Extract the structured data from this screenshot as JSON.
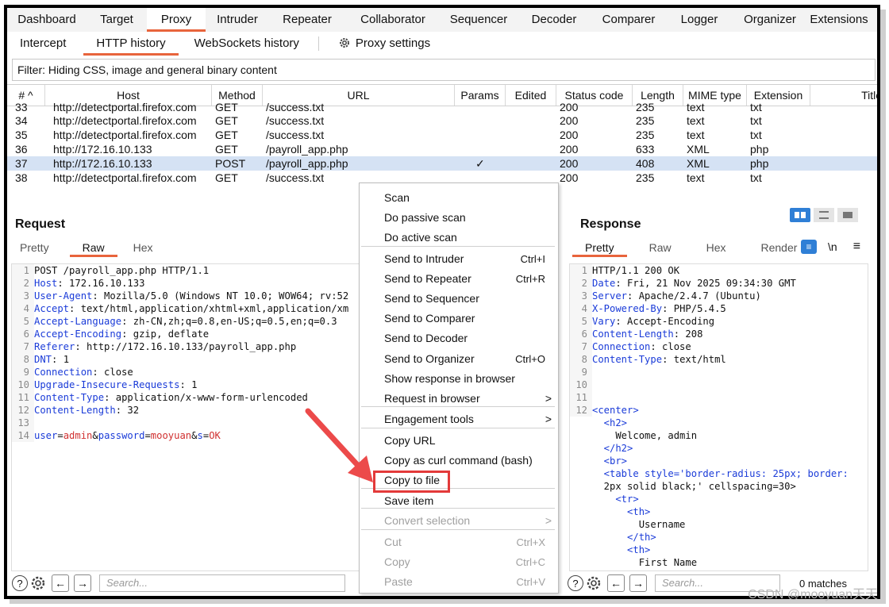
{
  "top_tabs": [
    "Dashboard",
    "Target",
    "Proxy",
    "Intruder",
    "Repeater",
    "Collaborator",
    "Sequencer",
    "Decoder",
    "Comparer",
    "Logger",
    "Organizer",
    "Extensions"
  ],
  "sub_tabs": [
    "Intercept",
    "HTTP history",
    "WebSockets history"
  ],
  "proxy_settings": "Proxy settings",
  "filter": "Filter: Hiding CSS, image and general binary content",
  "table": {
    "headers": [
      "# ^",
      "Host",
      "Method",
      "URL",
      "Params",
      "Edited",
      "Status code",
      "Length",
      "MIME type",
      "Extension",
      "Title"
    ],
    "rows": [
      {
        "n": "33",
        "host": "http://detectportal.firefox.com",
        "method": "GET",
        "url": "/success.txt",
        "params": "",
        "status": "200",
        "length": "235",
        "mime": "text",
        "ext": "txt"
      },
      {
        "n": "34",
        "host": "http://detectportal.firefox.com",
        "method": "GET",
        "url": "/success.txt",
        "params": "",
        "status": "200",
        "length": "235",
        "mime": "text",
        "ext": "txt"
      },
      {
        "n": "35",
        "host": "http://detectportal.firefox.com",
        "method": "GET",
        "url": "/success.txt",
        "params": "",
        "status": "200",
        "length": "235",
        "mime": "text",
        "ext": "txt"
      },
      {
        "n": "36",
        "host": "http://172.16.10.133",
        "method": "GET",
        "url": "/payroll_app.php",
        "params": "",
        "status": "200",
        "length": "633",
        "mime": "XML",
        "ext": "php"
      },
      {
        "n": "37",
        "host": "http://172.16.10.133",
        "method": "POST",
        "url": "/payroll_app.php",
        "params": "✓",
        "status": "200",
        "length": "408",
        "mime": "XML",
        "ext": "php"
      },
      {
        "n": "38",
        "host": "http://detectportal.firefox.com",
        "method": "GET",
        "url": "/success.txt",
        "params": "",
        "status": "200",
        "length": "235",
        "mime": "text",
        "ext": "txt"
      }
    ]
  },
  "request": {
    "title": "Request",
    "tabs": [
      "Pretty",
      "Raw",
      "Hex"
    ],
    "lines": [
      {
        "n": "1",
        "k": "",
        "t": "POST /payroll_app.php HTTP/1.1"
      },
      {
        "n": "2",
        "k": "Host",
        "t": ": 172.16.10.133"
      },
      {
        "n": "3",
        "k": "User-Agent",
        "t": ": Mozilla/5.0 (Windows NT 10.0; WOW64; rv:52"
      },
      {
        "n": "4",
        "k": "Accept",
        "t": ": text/html,application/xhtml+xml,application/xm"
      },
      {
        "n": "5",
        "k": "Accept-Language",
        "t": ": zh-CN,zh;q=0.8,en-US;q=0.5,en;q=0.3"
      },
      {
        "n": "6",
        "k": "Accept-Encoding",
        "t": ": gzip, deflate"
      },
      {
        "n": "7",
        "k": "Referer",
        "t": ": http://172.16.10.133/payroll_app.php"
      },
      {
        "n": "8",
        "k": "DNT",
        "t": ": 1"
      },
      {
        "n": "9",
        "k": "Connection",
        "t": ": close"
      },
      {
        "n": "10",
        "k": "Upgrade-Insecure-Requests",
        "t": ": 1"
      },
      {
        "n": "11",
        "k": "Content-Type",
        "t": ": application/x-www-form-urlencoded"
      },
      {
        "n": "12",
        "k": "Content-Length",
        "t": ": 32"
      },
      {
        "n": "13",
        "k": "",
        "t": ""
      },
      {
        "n": "14",
        "k": "",
        "t": ""
      }
    ],
    "body": [
      {
        "k": "user",
        "v": "admin"
      },
      {
        "k": "password",
        "v": "mooyuan"
      },
      {
        "k": "s",
        "v": "OK"
      }
    ],
    "search_placeholder": "Search..."
  },
  "response": {
    "title": "Response",
    "tabs": [
      "Pretty",
      "Raw",
      "Hex",
      "Render"
    ],
    "newline_icon": "\\n",
    "lines": [
      {
        "n": "1",
        "k": "",
        "t": "HTTP/1.1 200 OK"
      },
      {
        "n": "2",
        "k": "Date",
        "t": ": Fri, 21 Nov 2025 09:34:30 GMT"
      },
      {
        "n": "3",
        "k": "Server",
        "t": ": Apache/2.4.7 (Ubuntu)"
      },
      {
        "n": "4",
        "k": "X-Powered-By",
        "t": ": PHP/5.4.5"
      },
      {
        "n": "5",
        "k": "Vary",
        "t": ": Accept-Encoding"
      },
      {
        "n": "6",
        "k": "Content-Length",
        "t": ": 208"
      },
      {
        "n": "7",
        "k": "Connection",
        "t": ": close"
      },
      {
        "n": "8",
        "k": "Content-Type",
        "t": ": text/html"
      },
      {
        "n": "9",
        "k": "",
        "t": ""
      },
      {
        "n": "10",
        "k": "",
        "t": ""
      },
      {
        "n": "11",
        "k": "",
        "t": ""
      },
      {
        "n": "12",
        "k": "",
        "t": "<center>"
      },
      {
        "n": "",
        "k": "",
        "t": "  <h2>"
      },
      {
        "n": "",
        "k": "",
        "t": "    Welcome, admin"
      },
      {
        "n": "",
        "k": "",
        "t": "  </h2>"
      },
      {
        "n": "",
        "k": "",
        "t": "  <br>"
      },
      {
        "n": "",
        "k": "",
        "t": "  <table style='border-radius: 25px; border:"
      },
      {
        "n": "",
        "k": "",
        "t": "  2px solid black;' cellspacing=30>"
      },
      {
        "n": "",
        "k": "",
        "t": "    <tr>"
      },
      {
        "n": "",
        "k": "",
        "t": "      <th>"
      },
      {
        "n": "",
        "k": "",
        "t": "        Username"
      },
      {
        "n": "",
        "k": "",
        "t": "      </th>"
      },
      {
        "n": "",
        "k": "",
        "t": "      <th>"
      },
      {
        "n": "",
        "k": "",
        "t": "        First Name"
      }
    ],
    "search_placeholder": "Search...",
    "matches": "0 matches"
  },
  "menu": {
    "items": [
      {
        "label": "Scan",
        "shortcut": "",
        "disabled": false
      },
      {
        "label": "Do passive scan",
        "shortcut": "",
        "disabled": false
      },
      {
        "label": "Do active scan",
        "shortcut": "",
        "disabled": false
      },
      {
        "label": "Send to Intruder",
        "shortcut": "Ctrl+I",
        "disabled": false
      },
      {
        "label": "Send to Repeater",
        "shortcut": "Ctrl+R",
        "disabled": false
      },
      {
        "label": "Send to Sequencer",
        "shortcut": "",
        "disabled": false
      },
      {
        "label": "Send to Comparer",
        "shortcut": "",
        "disabled": false
      },
      {
        "label": "Send to Decoder",
        "shortcut": "",
        "disabled": false
      },
      {
        "label": "Send to Organizer",
        "shortcut": "Ctrl+O",
        "disabled": false
      },
      {
        "label": "Show response in browser",
        "shortcut": "",
        "disabled": false
      },
      {
        "label": "Request in browser",
        "shortcut": ">",
        "disabled": false
      },
      {
        "label": "Engagement tools",
        "shortcut": ">",
        "disabled": false
      },
      {
        "label": "Copy URL",
        "shortcut": "",
        "disabled": false
      },
      {
        "label": "Copy as curl command (bash)",
        "shortcut": "",
        "disabled": false
      },
      {
        "label": "Copy to file",
        "shortcut": "",
        "disabled": false
      },
      {
        "label": "Save item",
        "shortcut": "",
        "disabled": false
      },
      {
        "label": "Convert selection",
        "shortcut": ">",
        "disabled": true
      },
      {
        "label": "Cut",
        "shortcut": "Ctrl+X",
        "disabled": true
      },
      {
        "label": "Copy",
        "shortcut": "Ctrl+C",
        "disabled": true
      },
      {
        "label": "Paste",
        "shortcut": "Ctrl+V",
        "disabled": true
      }
    ]
  },
  "watermark": "CSDN @mooyuan天天",
  "colors": {
    "accent": "#e8643c",
    "selected_row": "#d5e2f4",
    "highlight": "#e33a3a",
    "header_key": "#1a3bd8"
  }
}
